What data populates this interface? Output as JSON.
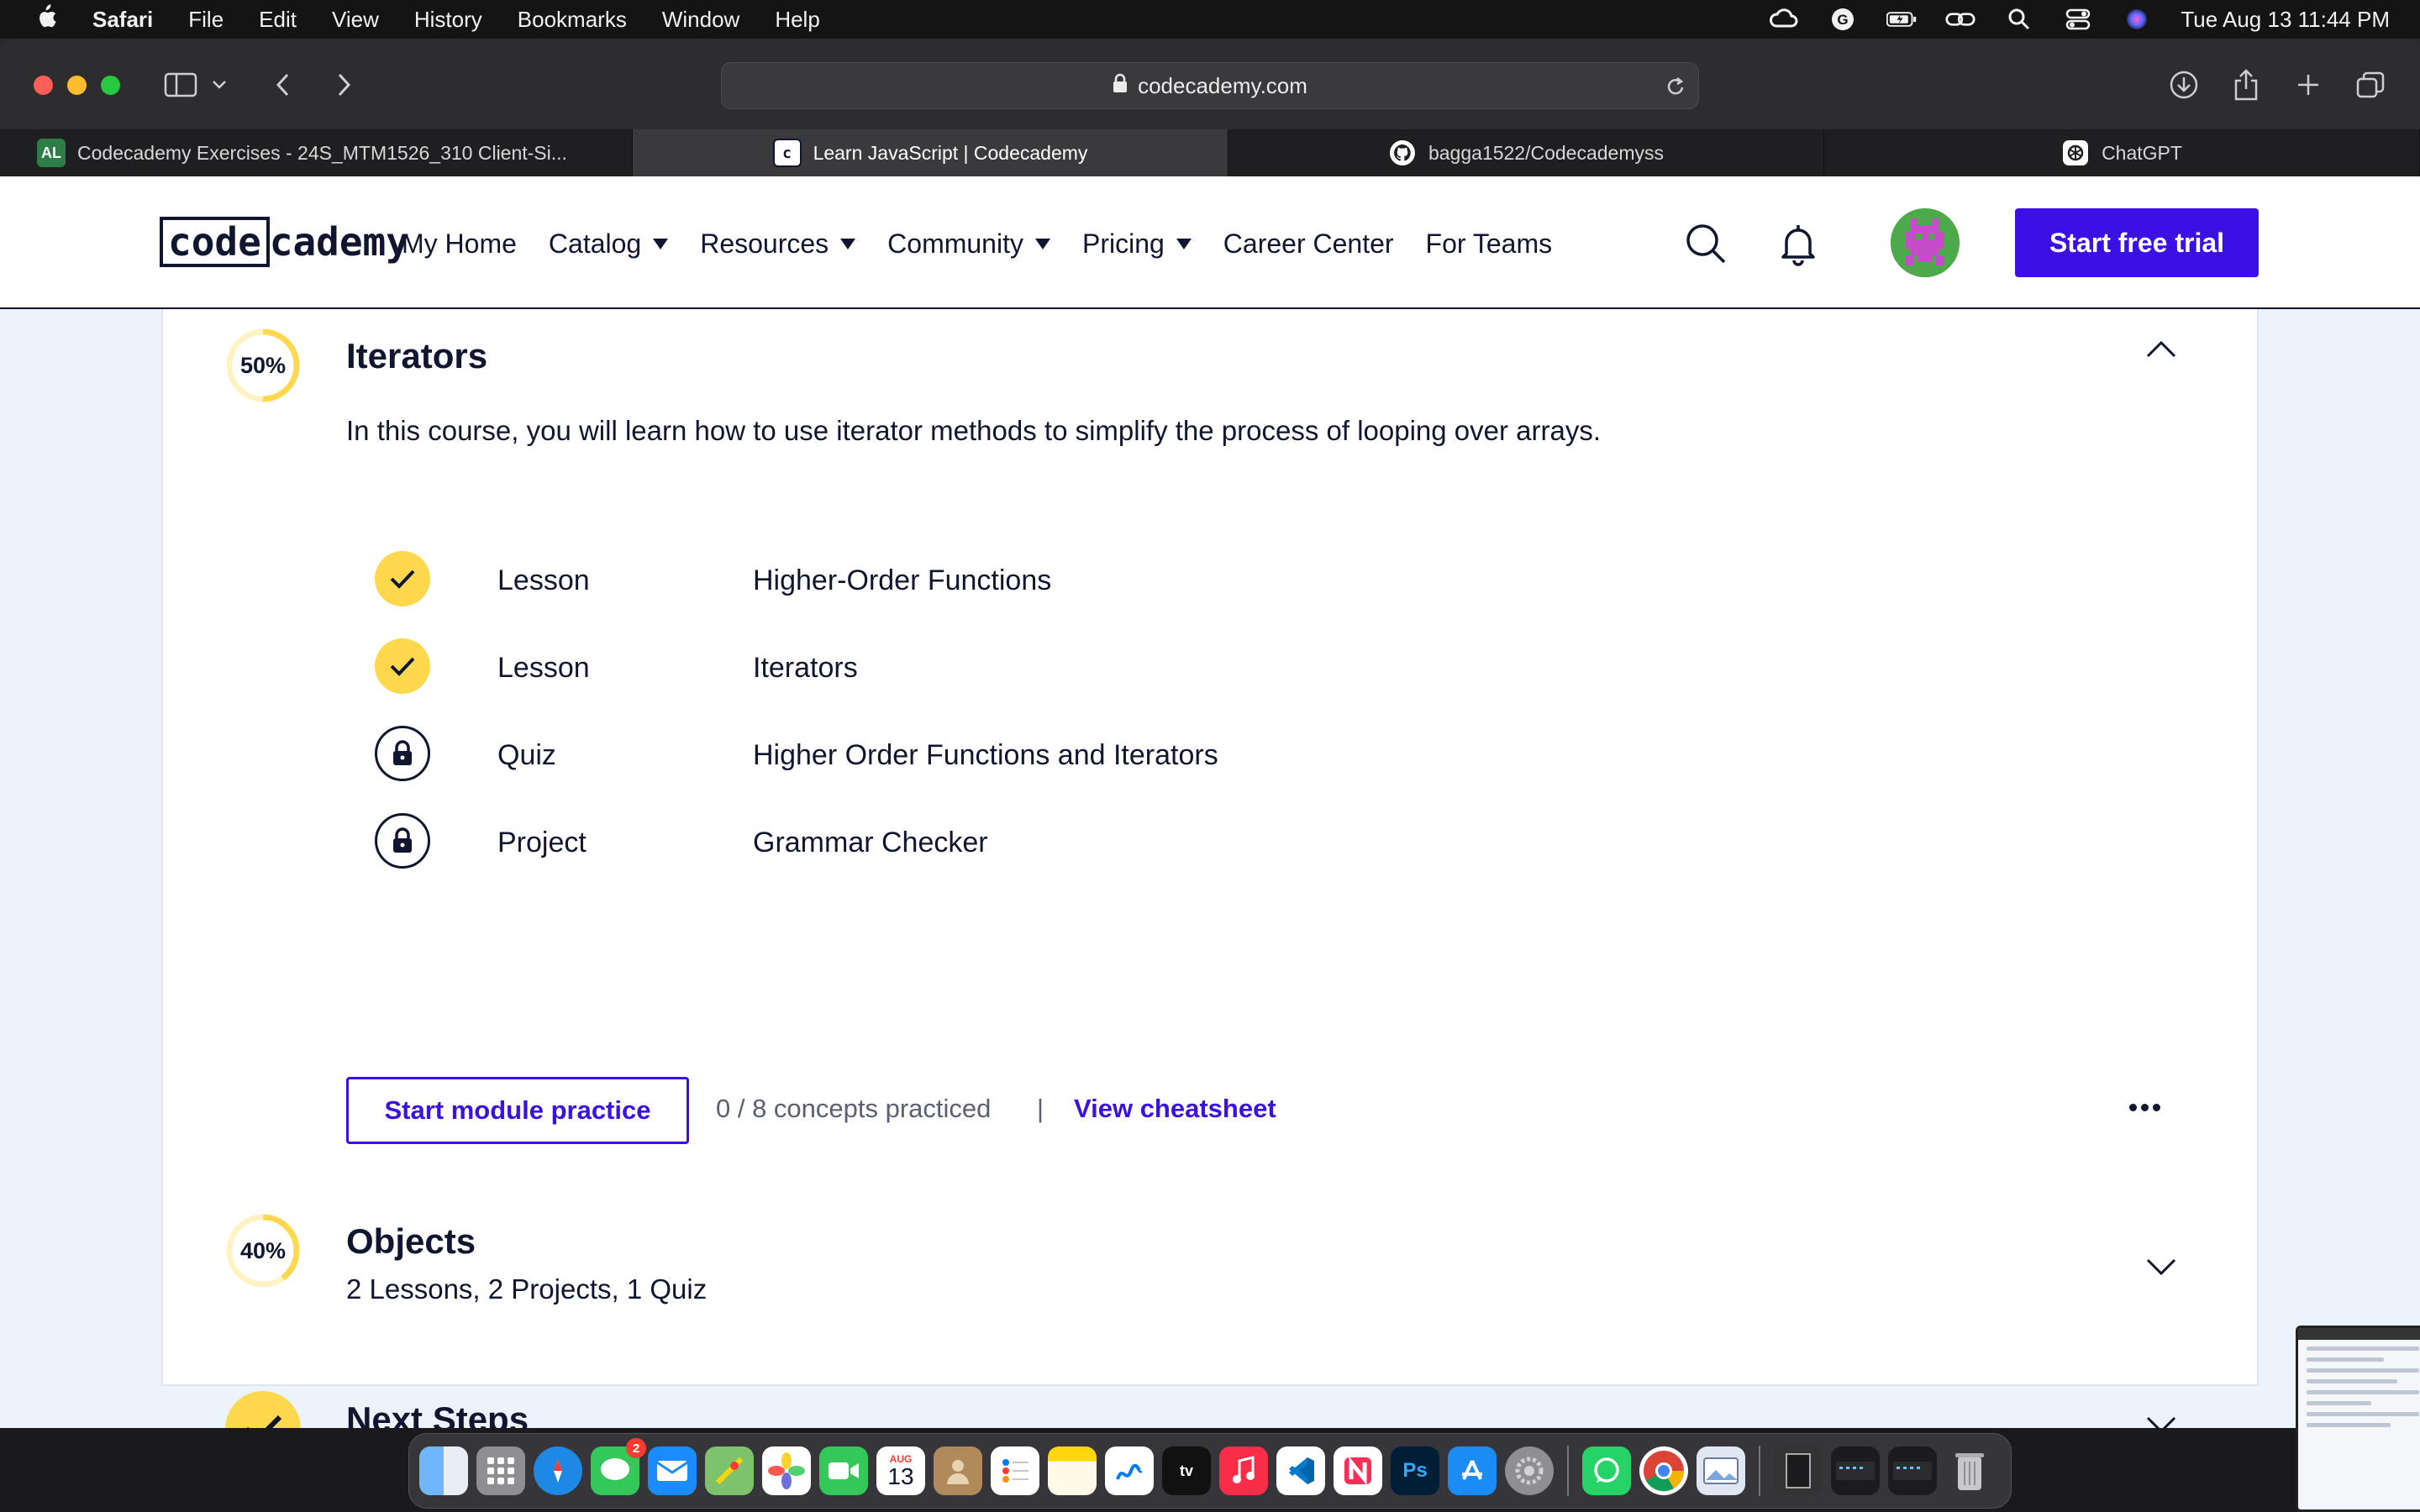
{
  "menubar": {
    "app": "Safari",
    "items": [
      "File",
      "Edit",
      "View",
      "History",
      "Bookmarks",
      "Window",
      "Help"
    ],
    "datetime": "Tue Aug 13  11:44 PM"
  },
  "browser": {
    "url": "codecademy.com",
    "tabs": [
      {
        "label": "Codecademy Exercises - 24S_MTM1526_310 Client-Si...",
        "favicon": "AL"
      },
      {
        "label": "Learn JavaScript | Codecademy",
        "favicon": "c"
      },
      {
        "label": "bagga1522/Codecademyss",
        "favicon": "github-icon"
      },
      {
        "label": "ChatGPT",
        "favicon": "chatgpt-icon"
      }
    ]
  },
  "header": {
    "logo_code": "code",
    "logo_cademy": "cademy",
    "nav": [
      {
        "label": "My Home",
        "dropdown": false
      },
      {
        "label": "Catalog",
        "dropdown": true
      },
      {
        "label": "Resources",
        "dropdown": true
      },
      {
        "label": "Community",
        "dropdown": true
      },
      {
        "label": "Pricing",
        "dropdown": true
      },
      {
        "label": "Career Center",
        "dropdown": false
      },
      {
        "label": "For Teams",
        "dropdown": false
      }
    ],
    "cta": "Start free trial"
  },
  "modules": {
    "iterators": {
      "progress_label": "50%",
      "progress": 0.5,
      "title": "Iterators",
      "description": "In this course, you will learn how to use iterator methods to simplify the process of looping over arrays.",
      "items": [
        {
          "type": "Lesson",
          "name": "Higher-Order Functions",
          "status": "complete"
        },
        {
          "type": "Lesson",
          "name": "Iterators",
          "status": "complete"
        },
        {
          "type": "Quiz",
          "name": "Higher Order Functions and Iterators",
          "status": "locked"
        },
        {
          "type": "Project",
          "name": "Grammar Checker",
          "status": "locked"
        }
      ],
      "practice_button": "Start module practice",
      "concepts": "0 / 8 concepts practiced",
      "separator": "|",
      "cheatsheet": "View cheatsheet"
    },
    "objects": {
      "progress_label": "40%",
      "progress": 0.4,
      "title": "Objects",
      "summary": "2 Lessons, 2 Projects, 1 Quiz"
    },
    "next_steps": {
      "title": "Next Steps"
    }
  },
  "dock": {
    "messages_badge": "2",
    "calendar_month": "AUG",
    "calendar_day": "13",
    "apps": [
      "finder",
      "launchpad",
      "safari",
      "messages",
      "mail",
      "maps",
      "photos",
      "facetime",
      "calendar",
      "contacts",
      "reminders",
      "notes",
      "freeform",
      "tv",
      "music",
      "vscode",
      "news",
      "photoshop",
      "app-store",
      "settings",
      "whatsapp",
      "chrome",
      "preview"
    ]
  },
  "colors": {
    "brand_blue": "#3a10e5",
    "navy": "#10162f",
    "yellow": "#ffd84d",
    "page_bg": "#ebf3fd"
  }
}
